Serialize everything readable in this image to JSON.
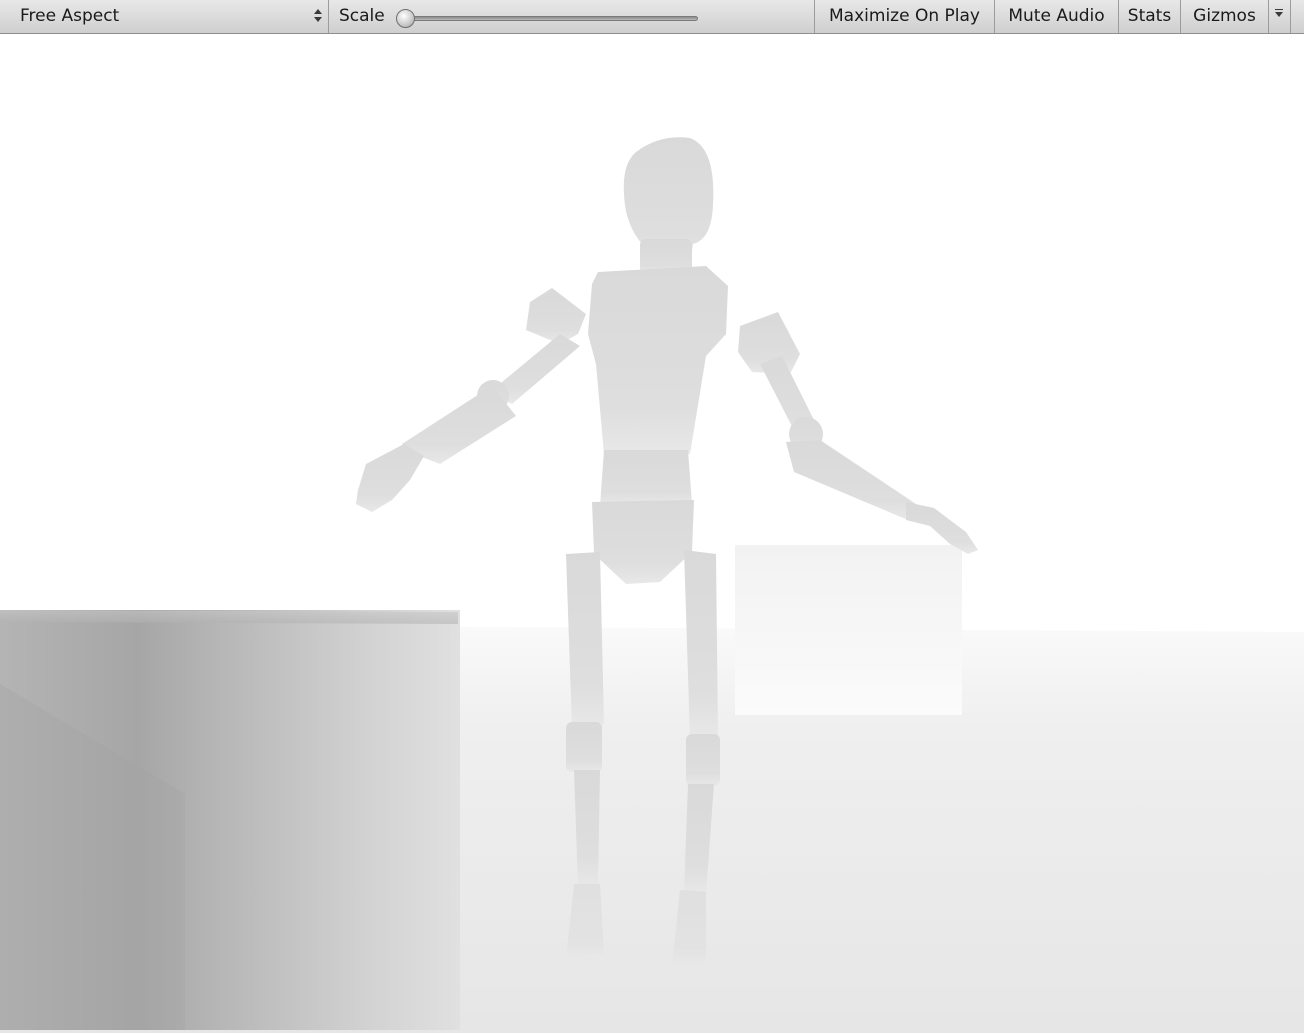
{
  "toolbar": {
    "aspect_label": "Free Aspect",
    "scale_label": "Scale",
    "scale_value": "1x",
    "scale_fraction": 0.0,
    "maximize_label": "Maximize On Play",
    "mute_label": "Mute Audio",
    "stats_label": "Stats",
    "gizmos_label": "Gizmos"
  },
  "icons": {
    "aspect_dropdown": "up-down-arrows-icon",
    "gizmos_dropdown": "chevron-down-icon"
  },
  "colors": {
    "toolbar_bg": "#d8d8d8",
    "sky": "#ffffff",
    "floor": "#e9e9e9",
    "robot": "#dadada",
    "box_dark": "#a8a8a8"
  }
}
